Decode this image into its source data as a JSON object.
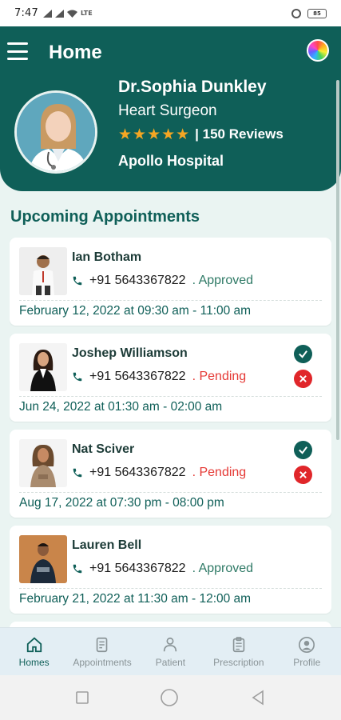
{
  "status_bar": {
    "time": "7:47",
    "battery": "85"
  },
  "header": {
    "title": "Home",
    "doctor_name": "Dr.Sophia Dunkley",
    "specialty": "Heart Surgeon",
    "stars": "★★★★★",
    "reviews": "| 150 Reviews",
    "hospital": "Apollo Hospital"
  },
  "section_title": "Upcoming Appointments",
  "appointments": [
    {
      "name": "Ian Botham",
      "phone": "+91 5643367822",
      "status": ". Approved",
      "status_type": "approved",
      "datetime": "February 12, 2022 at 09:30 am - 11:00 am",
      "actions": false
    },
    {
      "name": "Joshep Williamson",
      "phone": "+91 5643367822",
      "status": ". Pending",
      "status_type": "pending",
      "datetime": "Jun 24, 2022 at 01:30 am - 02:00 am",
      "actions": true
    },
    {
      "name": "Nat Sciver",
      "phone": "+91 5643367822",
      "status": ". Pending",
      "status_type": "pending",
      "datetime": "Aug 17, 2022 at 07:30 pm - 08:00 pm",
      "actions": true
    },
    {
      "name": "Lauren Bell",
      "phone": "+91 5643367822",
      "status": ". Approved",
      "status_type": "approved",
      "datetime": "February 21, 2022 at 11:30 am - 12:00 am",
      "actions": false
    }
  ],
  "nav": [
    {
      "label": "Homes",
      "icon": "home-icon",
      "active": true
    },
    {
      "label": "Appointments",
      "icon": "appointments-icon",
      "active": false
    },
    {
      "label": "Patient",
      "icon": "patient-icon",
      "active": false
    },
    {
      "label": "Prescription",
      "icon": "prescription-icon",
      "active": false
    },
    {
      "label": "Profile",
      "icon": "profile-icon",
      "active": false
    }
  ],
  "colors": {
    "primary": "#0f5f58",
    "approved": "#2f7a66",
    "pending": "#e53935",
    "star": "#f5a623"
  }
}
